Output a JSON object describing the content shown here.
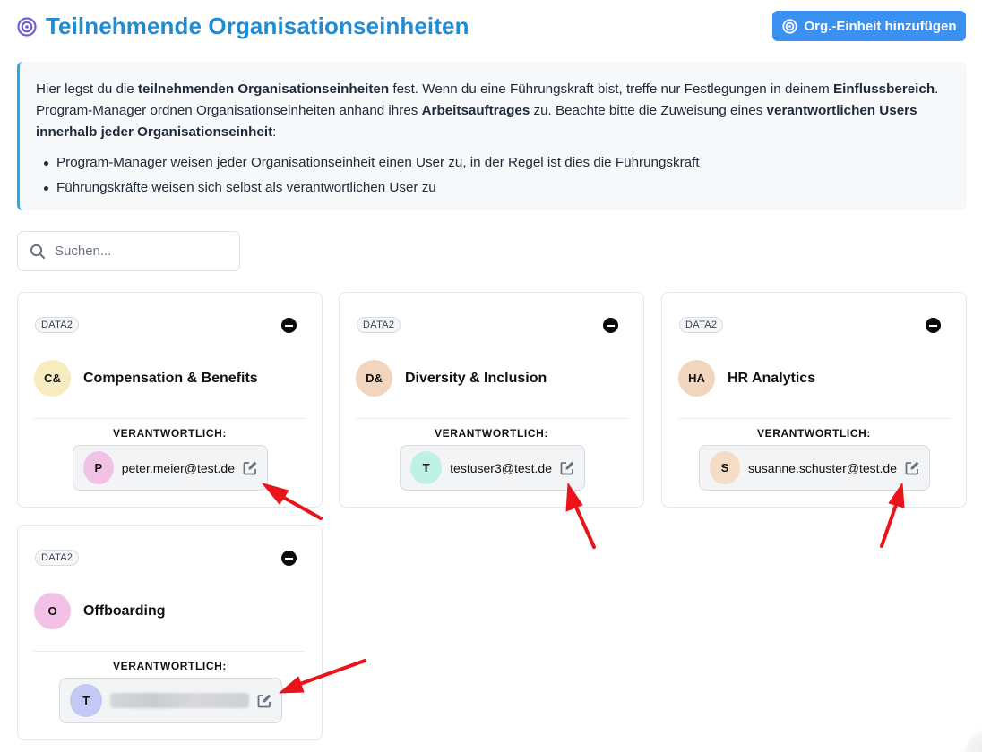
{
  "header": {
    "title": "Teilnehmende Organisationseinheiten",
    "title_icon": "target-icon",
    "add_button_label": "Org.-Einheit hinzufügen",
    "add_button_icon": "target-icon",
    "title_color": "#1f8dd6",
    "button_color": "#3b91f2"
  },
  "info": {
    "p1_a": "Hier legst du die ",
    "p1_b": "teilnehmenden Organisationseinheiten",
    "p1_c": " fest. Wenn du eine Führungskraft bist, treffe nur Festlegungen in deinem ",
    "p1_d": "Einflussbereich",
    "p1_e": ". Program-Manager ordnen Organisationseinheiten anhand ihres ",
    "p1_f": "Arbeitsauftrages",
    "p1_g": " zu. Beachte bitte die Zuweisung eines ",
    "p1_h": "verantwortlichen Users innerhalb jeder Organisationseinheit",
    "p1_i": ":",
    "bullets": [
      "Program-Manager weisen jeder Organisationseinheit einen User zu, in der Regel ist dies die Führungskraft",
      "Führungskräfte weisen sich selbst als verantwortlichen User zu"
    ],
    "accent_color": "#2aa9e0"
  },
  "search": {
    "placeholder": "Suchen..."
  },
  "responsible_label": "VERANTWORTLICH:",
  "cards": [
    {
      "badge": "DATA2",
      "initials": "C&",
      "name": "Compensation & Benefits",
      "avatar_color": "#f7ecc0",
      "user_initial": "P",
      "user_email": "peter.meier@test.de",
      "user_avatar_color": "#f2c2e6"
    },
    {
      "badge": "DATA2",
      "initials": "D&",
      "name": "Diversity & Inclusion",
      "avatar_color": "#f2d5bd",
      "user_initial": "T",
      "user_email": "testuser3@test.de",
      "user_avatar_color": "#bff0e6"
    },
    {
      "badge": "DATA2",
      "initials": "HA",
      "name": "HR Analytics",
      "avatar_color": "#f2d5bd",
      "user_initial": "S",
      "user_email": "susanne.schuster@test.de",
      "user_avatar_color": "#f5dcc4"
    },
    {
      "badge": "DATA2",
      "initials": "O",
      "name": "Offboarding",
      "avatar_color": "#f2c2e6",
      "user_initial": "T",
      "user_email": "",
      "user_email_blurred": true,
      "user_avatar_color": "#c3c8f5"
    }
  ],
  "annotation_arrow_color": "#e8141a"
}
